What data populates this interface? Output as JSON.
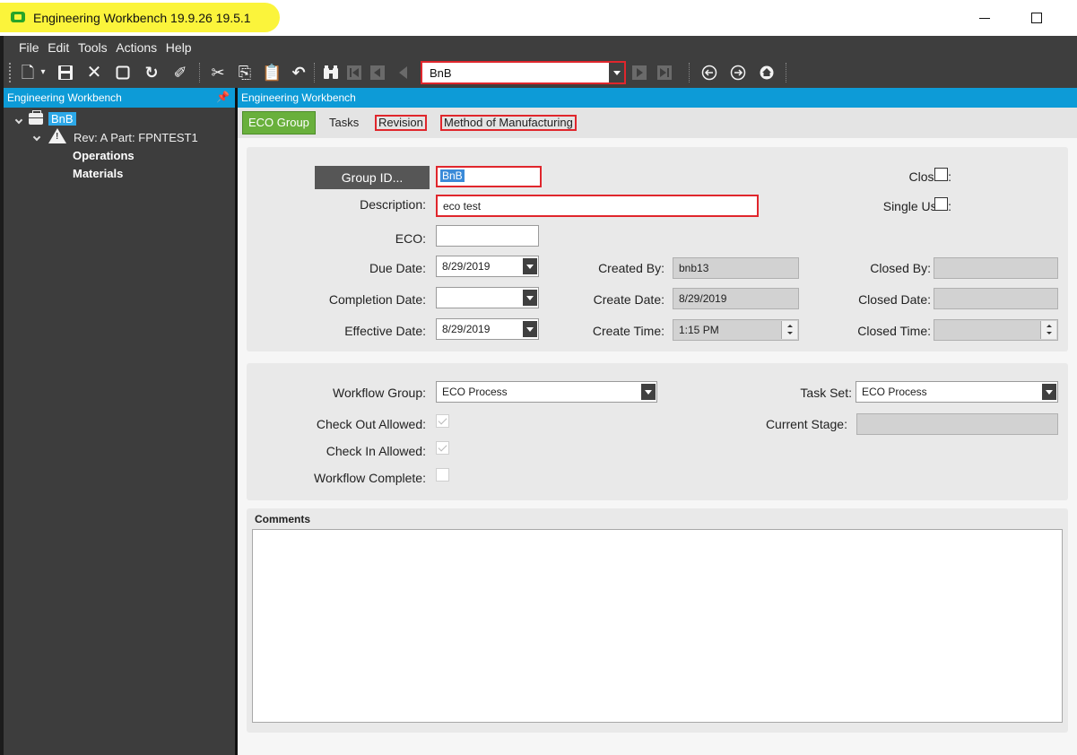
{
  "window": {
    "title": "Engineering Workbench 19.9.26 19.5.1"
  },
  "menu": [
    "File",
    "Edit",
    "Tools",
    "Actions",
    "Help"
  ],
  "toolbar": {
    "nav_value": "BnB",
    "icons": [
      "new-icon",
      "save-icon",
      "delete-icon",
      "clear-icon",
      "refresh-icon",
      "undo-brush-icon",
      "cut-icon",
      "copy-icon",
      "paste-icon",
      "undo-icon",
      "search-icon",
      "first-record-icon",
      "prev-record-icon",
      "next-record-icon",
      "last-record-icon",
      "back-icon",
      "forward-icon",
      "home-icon"
    ]
  },
  "left_panel": {
    "title": "Engineering Workbench",
    "tree": {
      "root": "BnB",
      "revision": "Rev: A Part: FPNTEST1",
      "children": [
        "Operations",
        "Materials"
      ]
    }
  },
  "right_panel": {
    "title": "Engineering Workbench",
    "tabs": [
      "ECO Group",
      "Tasks",
      "Revision",
      "Method of Manufacturing"
    ]
  },
  "form": {
    "group_id_button": "Group ID...",
    "group_id_value": "BnB",
    "description_label": "Description:",
    "description_value": "eco test",
    "eco_label": "ECO:",
    "eco_value": "",
    "due_date_label": "Due Date:",
    "due_date_value": "8/29/2019",
    "completion_date_label": "Completion Date:",
    "completion_date_value": "",
    "effective_date_label": "Effective Date:",
    "effective_date_value": "8/29/2019",
    "created_by_label": "Created By:",
    "created_by_value": "bnb13",
    "create_date_label": "Create Date:",
    "create_date_value": "8/29/2019",
    "create_time_label": "Create Time:",
    "create_time_value": "1:15 PM",
    "closed_label": "Closed:",
    "single_user_label": "Single User:",
    "closed_by_label": "Closed By:",
    "closed_by_value": "",
    "closed_date_label": "Closed Date:",
    "closed_date_value": "",
    "closed_time_label": "Closed Time:",
    "closed_time_value": ""
  },
  "workflow": {
    "workflow_group_label": "Workflow Group:",
    "workflow_group_value": "ECO Process",
    "task_set_label": "Task Set:",
    "task_set_value": "ECO Process",
    "check_out_label": "Check Out Allowed:",
    "check_in_label": "Check In Allowed:",
    "complete_label": "Workflow Complete:",
    "current_stage_label": "Current Stage:",
    "current_stage_value": ""
  },
  "comments": {
    "label": "Comments",
    "value": ""
  }
}
